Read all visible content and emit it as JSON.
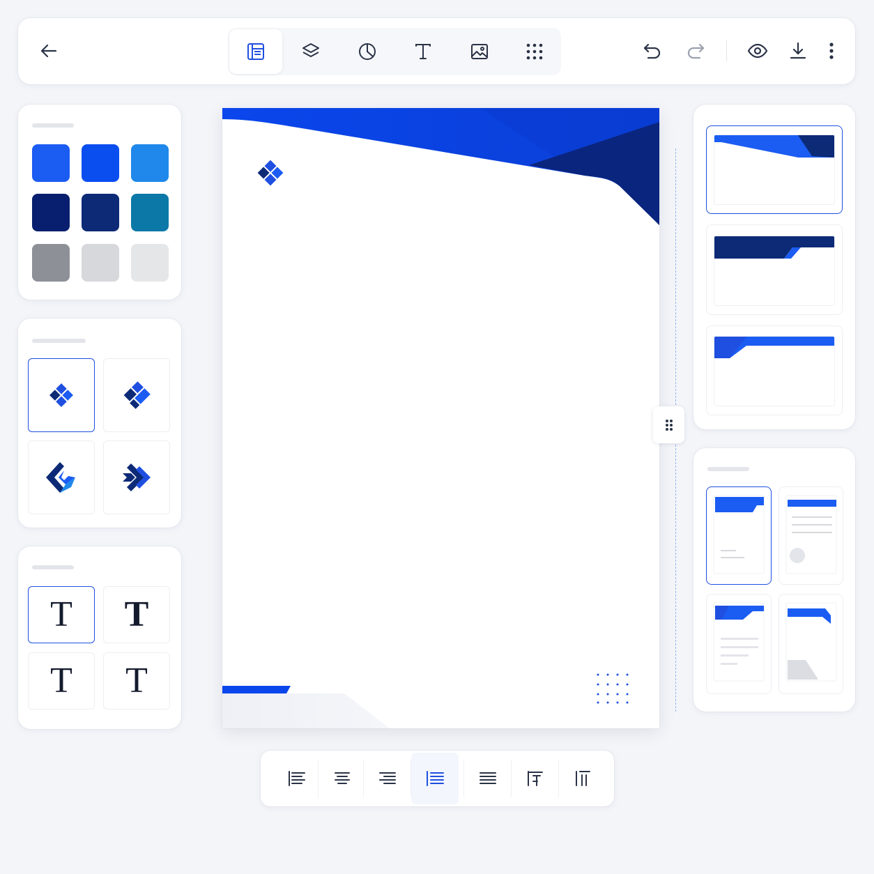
{
  "toolbar": {
    "back_icon": "arrow-left-icon",
    "tools": [
      "layout-icon",
      "layers-icon",
      "pie-chart-icon",
      "text-icon",
      "image-icon",
      "grid-dots-icon"
    ],
    "active_tool": "layout-icon",
    "actions": [
      "undo-icon",
      "redo-icon",
      "preview-eye-icon",
      "download-icon",
      "more-vertical-icon"
    ]
  },
  "colors": {
    "accent": "#1f4fe0",
    "palette": [
      "#1b5cf2",
      "#0a4ef0",
      "#1f88ea",
      "#071f6e",
      "#0c2a76",
      "#0b78a8",
      "#8e9098",
      "#d7d8dc",
      "#e5e6e8"
    ]
  },
  "logos": [
    "diamond-cluster-logo",
    "diagonal-blocks-logo",
    "g-shape-logo",
    "chevron-arrow-logo"
  ],
  "fonts": {
    "samples": [
      "T",
      "T",
      "T",
      "T"
    ]
  },
  "alignment": [
    "align-left-icon",
    "align-center-icon",
    "align-right-icon",
    "align-justify-left-icon",
    "align-justify-icon",
    "align-top-icon",
    "align-vertical-icon"
  ],
  "active_alignment": "align-justify-left-icon"
}
